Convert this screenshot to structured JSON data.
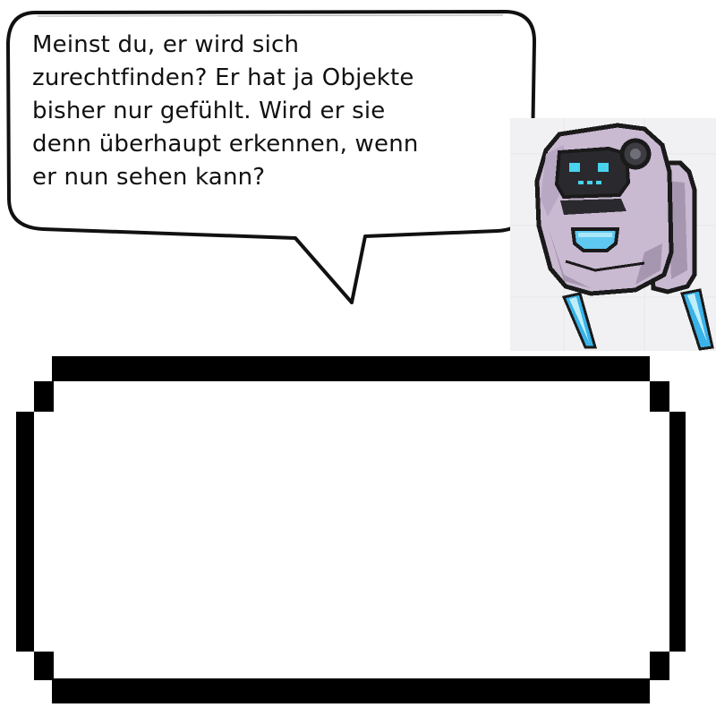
{
  "speech_bubble": {
    "lines": [
      "Meinst du, er wird sich",
      "zurechtfinden? Er hat ja Objekte",
      "bisher nur gefühlt. Wird er sie",
      "denn überhaupt erkennen, wenn",
      "er nun sehen kann?"
    ]
  },
  "character": {
    "icon": "robot-icon",
    "colors": {
      "body": "#c9b9d1",
      "body_shade": "#a796b0",
      "outline": "#1a1a1a",
      "visor": "#2a2a2e",
      "eyes": "#49d3ee",
      "mouth": "#5ec8f0",
      "thruster": "#3ab3e8"
    }
  },
  "dialog_box": {
    "text": ""
  }
}
